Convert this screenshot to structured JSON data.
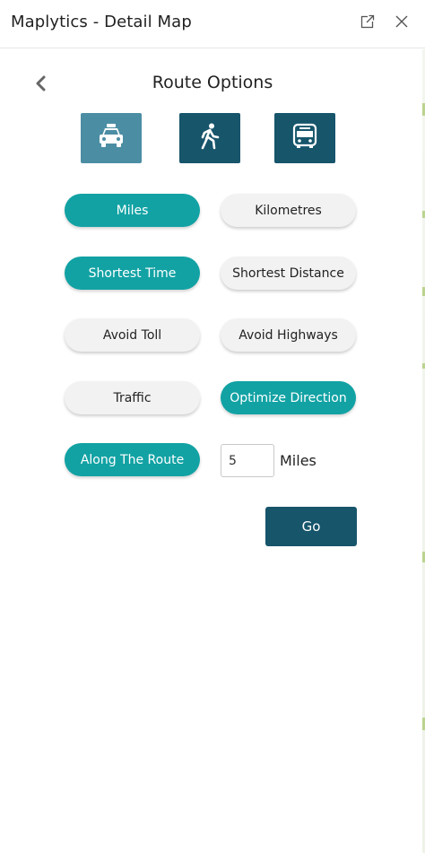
{
  "window": {
    "title": "Maplytics - Detail Map",
    "popout_icon": "popout-icon",
    "close_icon": "close-icon"
  },
  "panel": {
    "title": "Route Options",
    "back_icon": "chevron-left-icon"
  },
  "travel_modes": [
    {
      "icon": "taxi-icon",
      "selected": true
    },
    {
      "icon": "walking-icon",
      "selected": false
    },
    {
      "icon": "bus-icon",
      "selected": false
    }
  ],
  "options": {
    "units": {
      "miles": "Miles",
      "kilometres": "Kilometres",
      "selected": "Miles"
    },
    "route_type": {
      "shortest_time": "Shortest Time",
      "shortest_distance": "Shortest Distance",
      "selected": "Shortest Time"
    },
    "avoid": {
      "toll": "Avoid Toll",
      "highways": "Avoid Highways"
    },
    "traffic": "Traffic",
    "optimize_direction": "Optimize Direction",
    "along_the_route": "Along The Route"
  },
  "distance": {
    "value": "5",
    "unit": "Miles"
  },
  "go_label": "Go",
  "colors": {
    "teal_active": "#12a2a4",
    "navy": "#17556b",
    "mode_selected": "#4b8ea4",
    "inactive_pill": "#f2f2f2"
  }
}
